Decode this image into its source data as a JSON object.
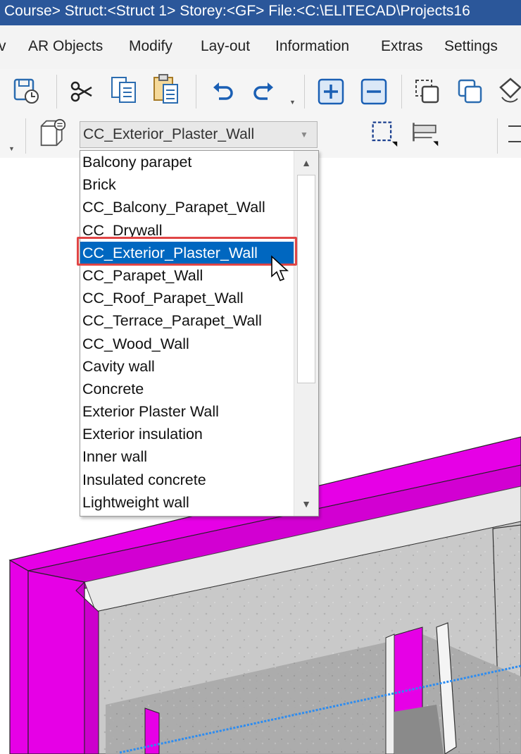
{
  "title_bar": {
    "text": "Course> Struct:<Struct 1>  Storey:<GF>  File:<C:\\ELITECAD\\Projects16"
  },
  "menu": {
    "items": [
      "v",
      "AR Objects",
      "Modify",
      "Lay-out",
      "Information",
      "Extras",
      "Settings"
    ]
  },
  "toolbar": {
    "icons": [
      "save-history-icon",
      "cut-icon",
      "copy-icon",
      "paste-icon",
      "undo-icon",
      "redo-icon",
      "zoom-in-icon",
      "zoom-out-icon",
      "select-window-icon",
      "duplicate-icon",
      "rotate-icon"
    ]
  },
  "combo": {
    "value": "CC_Exterior_Plaster_Wall"
  },
  "dropdown": {
    "items": [
      "Balcony parapet",
      "Brick",
      "CC_Balcony_Parapet_Wall",
      "CC_Drywall",
      "CC_Exterior_Plaster_Wall",
      "CC_Parapet_Wall",
      "CC_Roof_Parapet_Wall",
      "CC_Terrace_Parapet_Wall",
      "CC_Wood_Wall",
      "Cavity wall",
      "Concrete",
      "Exterior Plaster Wall",
      "Exterior insulation",
      "Inner wall",
      "Insulated concrete",
      "Lightweight wall"
    ],
    "selected_index": 4
  },
  "colors": {
    "title_bar": "#2b579a",
    "selection": "#0067c0",
    "highlight_box": "#e04545",
    "wall_magenta": "#e600e6"
  }
}
